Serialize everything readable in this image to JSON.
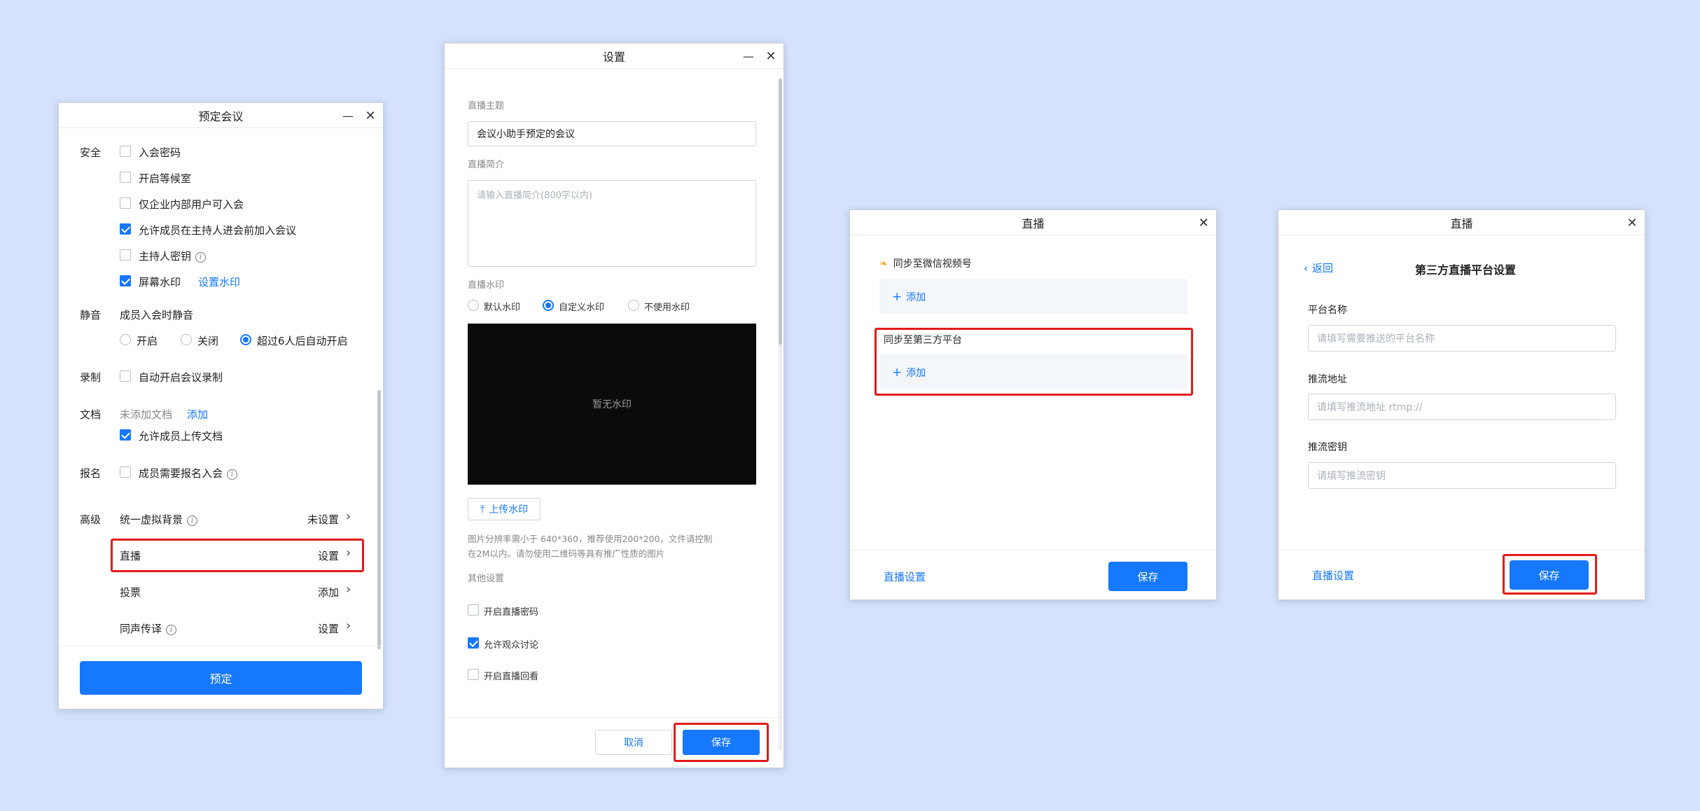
{
  "win1": {
    "title": "预定会议",
    "sections": {
      "security": "安全",
      "mute": "静音",
      "record": "录制",
      "docs": "文档",
      "signup": "报名",
      "advanced": "高级"
    },
    "security_items": [
      "入会密码",
      "开启等候室",
      "仅企业内部用户可入会",
      "允许成员在主持人进会前加入会议",
      "主持人密钥",
      "屏幕水印"
    ],
    "watermark_link": "设置水印",
    "mute_label": "成员入会时静音",
    "mute_options": [
      "开启",
      "关闭",
      "超过6人后自动开启"
    ],
    "record_item": "自动开启会议录制",
    "docs_status": "未添加文档",
    "docs_add": "添加",
    "docs_allow": "允许成员上传文档",
    "signup_item": "成员需要报名入会",
    "adv_rows": [
      {
        "label": "统一虚拟背景",
        "value": "未设置"
      },
      {
        "label": "直播",
        "value": "设置"
      },
      {
        "label": "投票",
        "value": "添加"
      },
      {
        "label": "同声传译",
        "value": "设置"
      }
    ],
    "submit": "预定"
  },
  "win2": {
    "title": "设置",
    "topic_label": "直播主题",
    "topic_value": "会议小助手预定的会议",
    "intro_label": "直播简介",
    "intro_placeholder": "请输入直播简介(800字以内)",
    "watermark_label": "直播水印",
    "wm_options": [
      "默认水印",
      "自定义水印",
      "不使用水印"
    ],
    "preview_text": "暂无水印",
    "upload": "上传水印",
    "hint_line1": "图片分辨率需小于 640*360，推荐使用200*200，文件请控制",
    "hint_line2": "在2M以内。请勿使用二维码等具有推广性质的图片",
    "other_label": "其他设置",
    "other_items": [
      "开启直播密码",
      "允许观众讨论",
      "开启直播回看"
    ],
    "cancel": "取消",
    "save": "保存"
  },
  "win3": {
    "title": "直播",
    "wechat_label": "同步至微信视频号",
    "add": "添加",
    "third_label": "同步至第三方平台",
    "footer_link": "直播设置",
    "save": "保存"
  },
  "win4": {
    "title": "直播",
    "back": "返回",
    "heading": "第三方直播平台设置",
    "name_label": "平台名称",
    "name_placeholder": "请填写需要推送的平台名称",
    "url_label": "推流地址",
    "url_placeholder": "请填写推流地址 rtmp://",
    "key_label": "推流密钥",
    "key_placeholder": "请填写推流密钥",
    "footer_link": "直播设置",
    "save": "保存"
  }
}
